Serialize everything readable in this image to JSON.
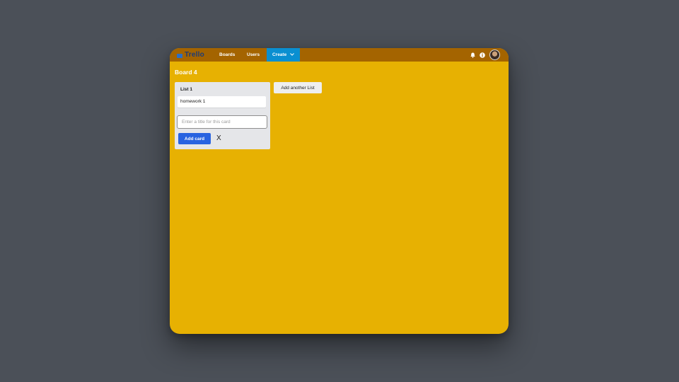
{
  "app": {
    "logo_text": "Trello"
  },
  "nav": {
    "boards": "Boards",
    "users": "Users",
    "create": "Create"
  },
  "icons": {
    "logo": "trello-board-icon",
    "create_chevron": "chevron-down-icon",
    "notifications": "bell-icon",
    "info": "info-icon",
    "avatar": "user-avatar"
  },
  "colors": {
    "board_background": "#e7b102",
    "topbar": "#a46400",
    "create_button": "#0a8fd1",
    "add_card_button": "#2863e0"
  },
  "board": {
    "title": "Board 4",
    "lists": [
      {
        "title": "List 1",
        "cards": [
          "homework 1"
        ]
      }
    ],
    "composer": {
      "placeholder": "Enter a title for this card",
      "value": "",
      "add_label": "Add card",
      "close_label": "X"
    },
    "add_list_label": "Add another List"
  }
}
